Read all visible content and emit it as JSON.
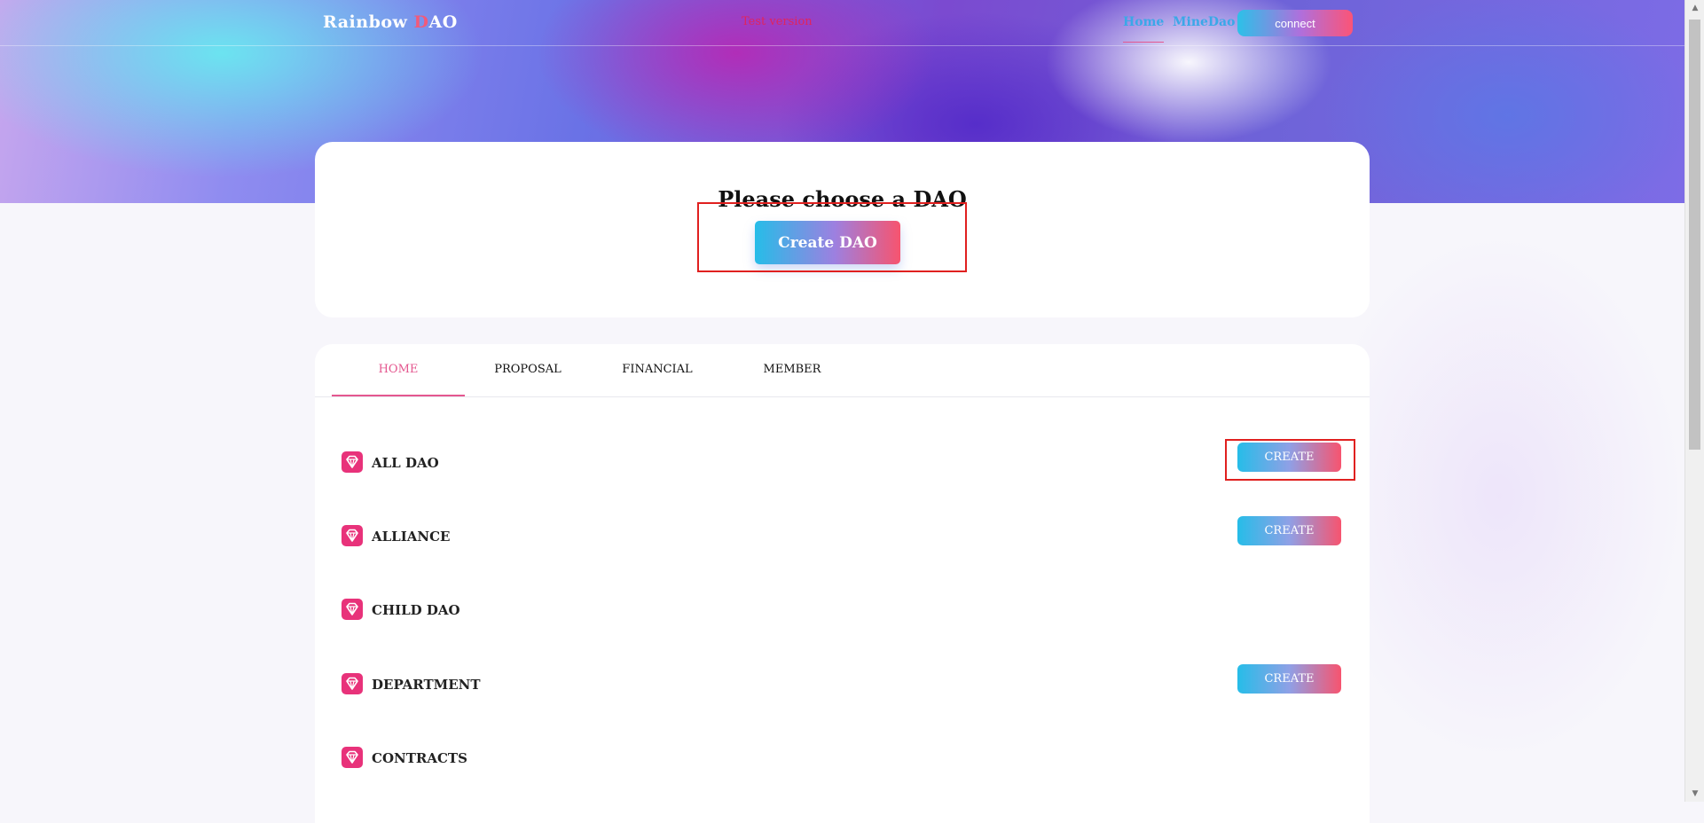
{
  "header": {
    "logo_main": "Rainbow ",
    "logo_d": "D",
    "logo_rest": "AO",
    "test_version": "Test version",
    "nav_home": "Home",
    "nav_mine": "MineDao",
    "connect_label": "connect"
  },
  "top_card": {
    "title": "Please choose a DAO",
    "create_dao_label": "Create DAO"
  },
  "tabs": [
    "HOME",
    "PROPOSAL",
    "FINANCIAL",
    "MEMBER"
  ],
  "active_tab": "HOME",
  "sections": [
    {
      "label": "ALL DAO",
      "button": "CREATE"
    },
    {
      "label": "ALLIANCE",
      "button": "CREATE"
    },
    {
      "label": "CHILD DAO",
      "button": ""
    },
    {
      "label": "DEPARTMENT",
      "button": "CREATE"
    },
    {
      "label": "CONTRACTS",
      "button": ""
    }
  ],
  "icons": {
    "row_icon": "diamond-icon",
    "scroll_up": "▲",
    "scroll_down": "▼"
  },
  "colors": {
    "accent_pink": "#e4578f",
    "link_blue": "#3aa8e8",
    "icon_pink": "#e8327a",
    "test_version_red": "#e0245e"
  }
}
